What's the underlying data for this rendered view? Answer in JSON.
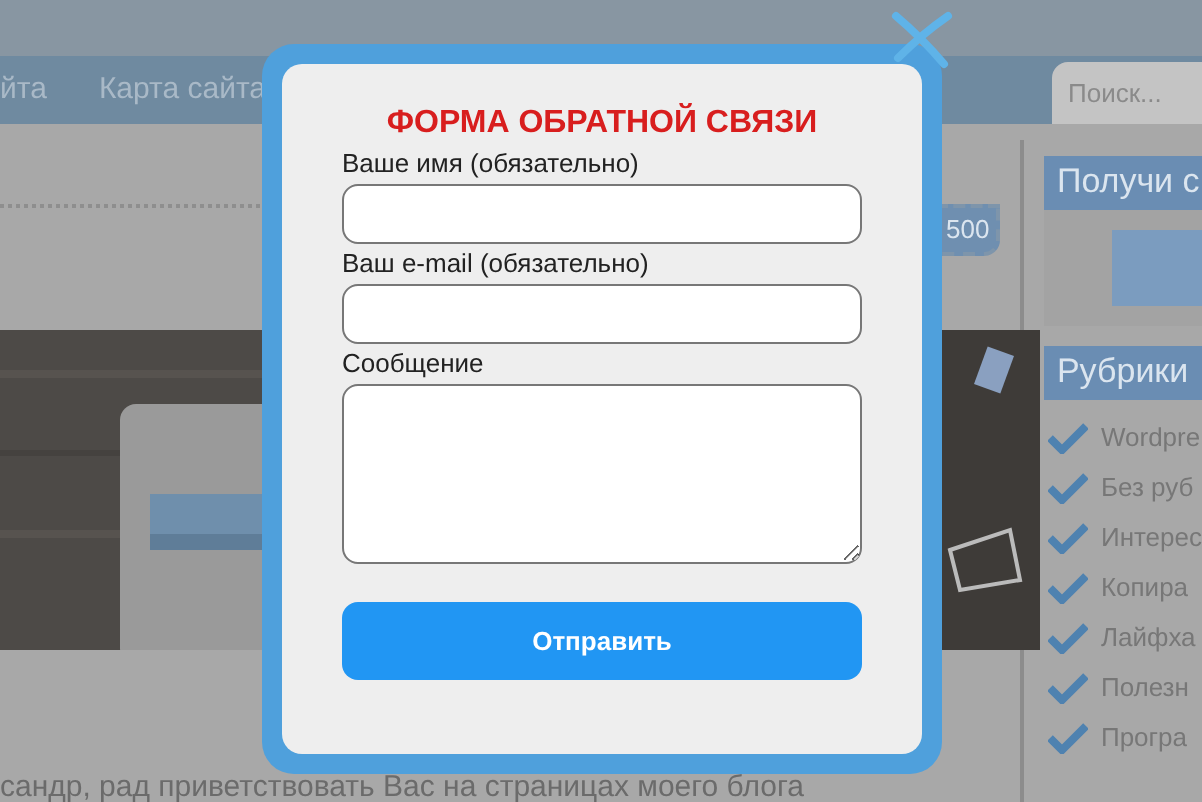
{
  "nav": {
    "items": [
      "йта",
      "Карта сайта"
    ]
  },
  "search": {
    "placeholder": "Поиск..."
  },
  "badge": "500",
  "sidebar": {
    "widget_title": "Получи с",
    "categories_title": "Рубрики",
    "categories": [
      "Wordpre",
      "Без руб",
      "Интерес",
      "Копира",
      "Лайфха",
      "Полезн",
      "Програ"
    ]
  },
  "intro_text": "сандр, рад приветствовать Вас на страницах моего блога",
  "modal": {
    "title": "ФОРМА ОБРАТНОЙ СВЯЗИ",
    "fields": [
      {
        "kind": "input",
        "label": "Ваше имя (обязательно)"
      },
      {
        "kind": "input",
        "label": "Ваш e-mail (обязательно)"
      },
      {
        "kind": "textarea",
        "label": "Сообщение"
      }
    ],
    "submit": "Отправить"
  }
}
